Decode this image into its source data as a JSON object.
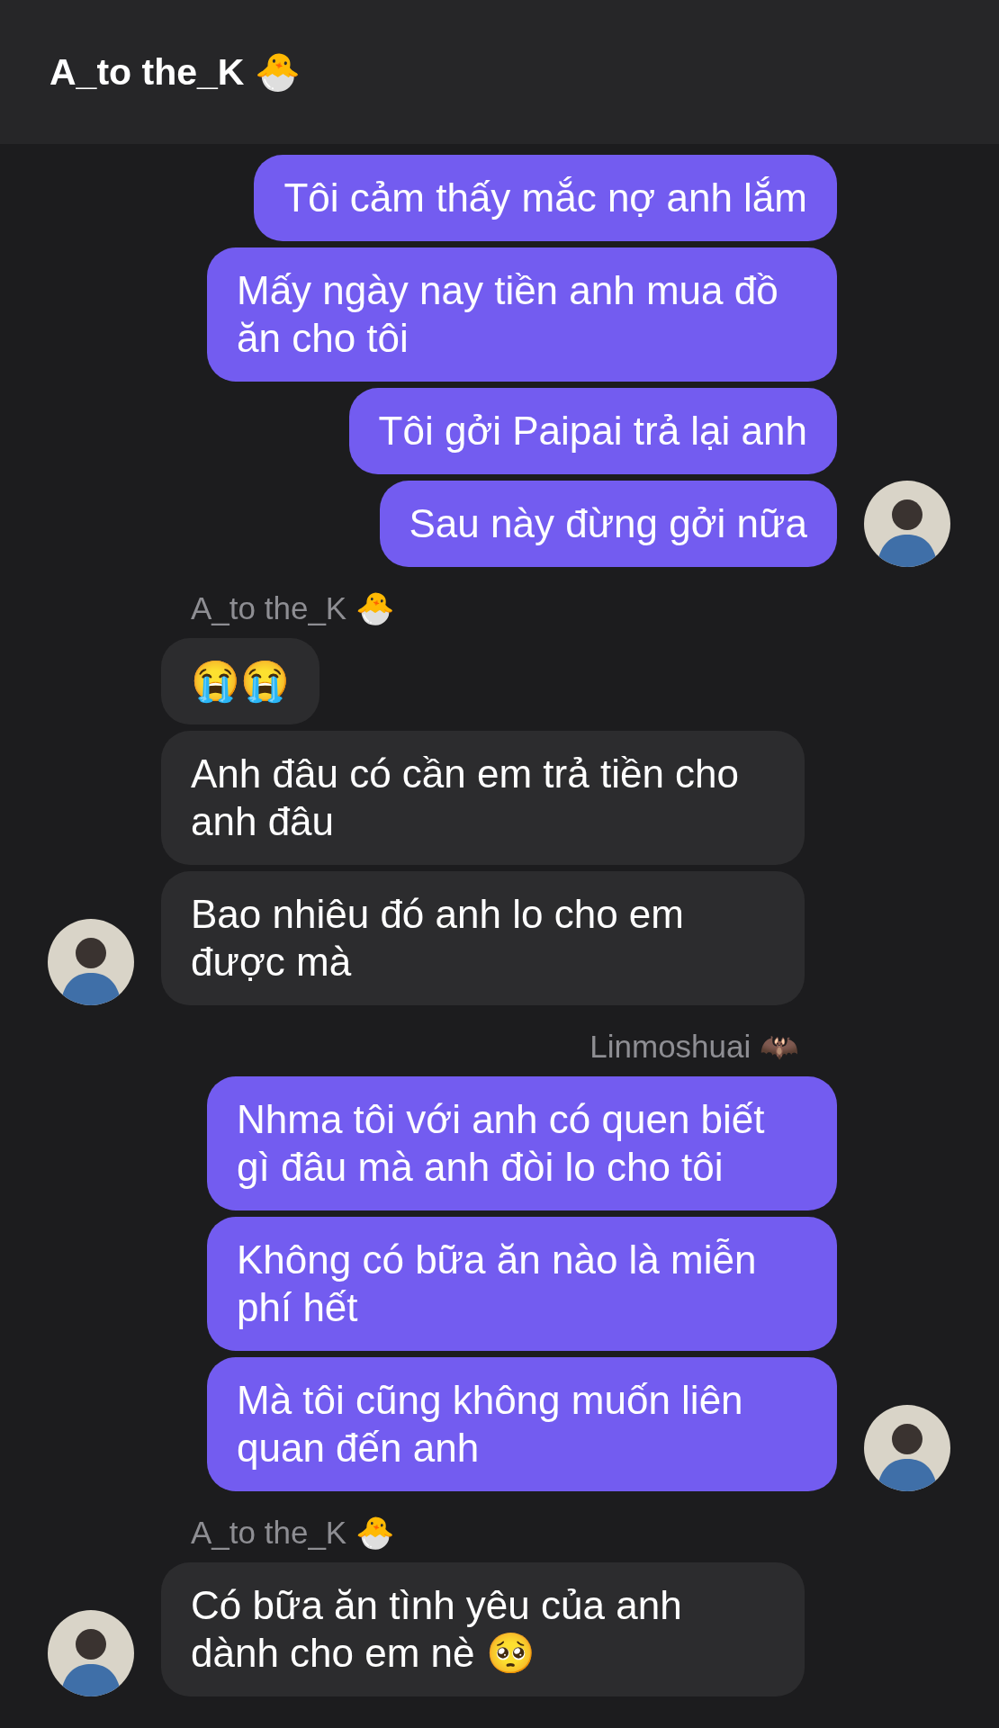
{
  "header": {
    "title": "A_to the_K 🐣"
  },
  "groups": [
    {
      "kind": "outgoing",
      "messages": [
        "Tôi cảm thấy mắc nợ anh lắm",
        "Mấy ngày nay tiền anh mua đồ ăn cho tôi",
        "Tôi gởi Paipai trả lại anh",
        "Sau này đừng gởi nữa"
      ]
    },
    {
      "kind": "incoming",
      "sender": "A_to the_K 🐣",
      "messages": [
        "😭😭",
        "Anh đâu có cần em trả tiền cho anh đâu",
        "Bao nhiêu đó anh lo cho em được mà"
      ]
    },
    {
      "kind": "outgoing",
      "sender": "Linmoshuai 🦇",
      "messages": [
        "Nhma tôi với anh có quen biết gì đâu mà anh đòi lo cho tôi",
        "Không có bữa ăn nào là miễn phí hết",
        "Mà tôi cũng không muốn liên quan đến anh"
      ]
    },
    {
      "kind": "incoming",
      "sender": "A_to the_K 🐣",
      "messages": [
        "Có bữa ăn tình yêu của anh dành cho em nè 🥺"
      ]
    }
  ]
}
